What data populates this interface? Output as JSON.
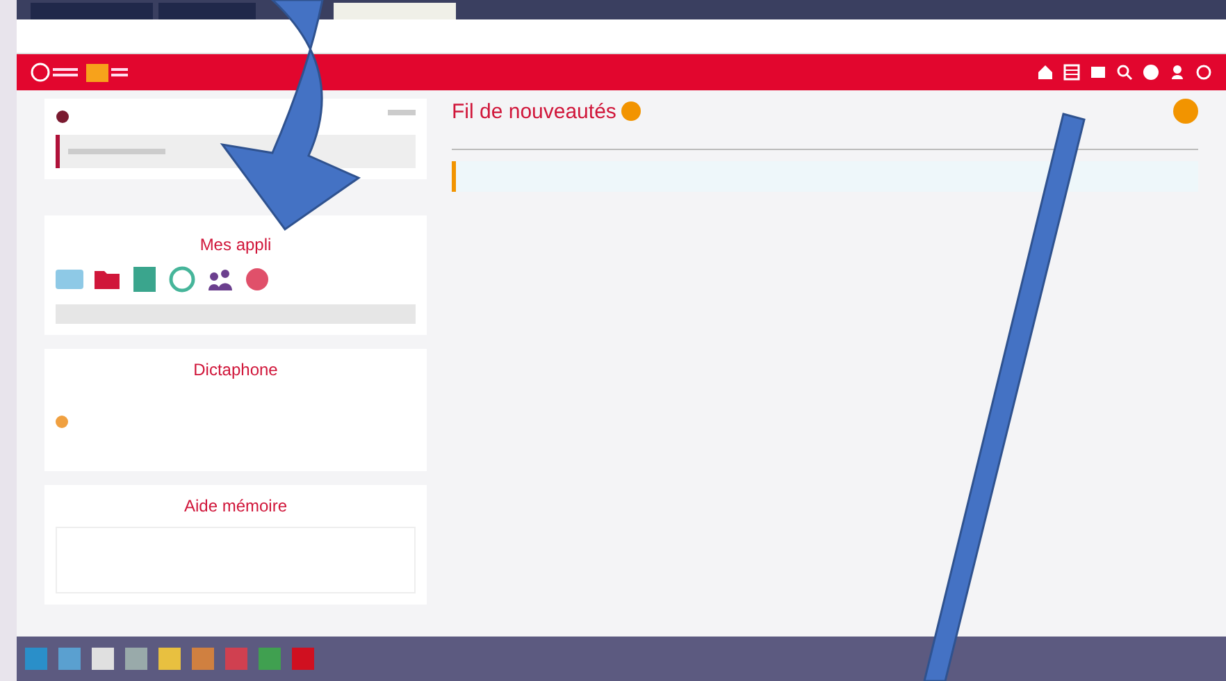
{
  "browser_tabs": [
    {
      "selected": false
    },
    {
      "selected": false
    },
    {
      "selected": true
    }
  ],
  "apps": {
    "title": "Mes appli",
    "items": [
      {
        "kind": "card",
        "color": "#8ec9e6"
      },
      {
        "kind": "folder",
        "color": "#d0163a"
      },
      {
        "kind": "contact",
        "color": "#3aa58d"
      },
      {
        "kind": "headset",
        "color": "#46b59a"
      },
      {
        "kind": "people",
        "color": "#6b3f8e"
      },
      {
        "kind": "stop",
        "color": "#e0506a"
      }
    ]
  },
  "dictaphone": {
    "title": "Dictaphone"
  },
  "memo": {
    "title": "Aide mémoire"
  },
  "feed": {
    "title": "Fil de nouveautés"
  }
}
